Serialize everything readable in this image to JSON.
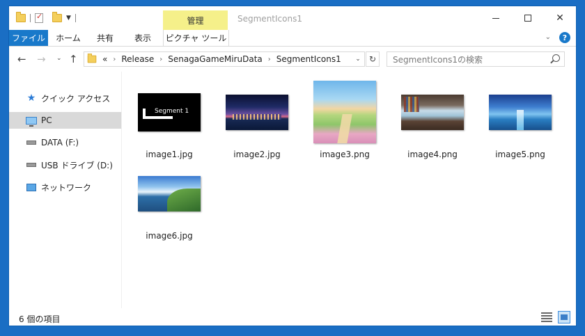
{
  "window": {
    "title": "SegmentIcons1",
    "manage_tab": "管理",
    "controls": {
      "minimize": "—",
      "maximize": "☐",
      "close": "✕"
    }
  },
  "ribbon": {
    "tabs": [
      {
        "label": "ファイル",
        "active": true
      },
      {
        "label": "ホーム"
      },
      {
        "label": "共有"
      },
      {
        "label": "表示"
      },
      {
        "label": "ピクチャ ツール"
      }
    ],
    "help_label": "?"
  },
  "address": {
    "overflow": "«",
    "crumbs": [
      "Release",
      "SenagaGameMiruData",
      "SegmentIcons1"
    ],
    "search_placeholder": "SegmentIcons1の検索"
  },
  "nav": {
    "items": [
      {
        "label": "クイック アクセス",
        "icon": "star-icon"
      },
      {
        "label": "PC",
        "icon": "pc-icon",
        "selected": true
      },
      {
        "label": "DATA (F:)",
        "icon": "drive-icon"
      },
      {
        "label": "USB ドライブ (D:)",
        "icon": "usb-drive-icon"
      },
      {
        "label": "ネットワーク",
        "icon": "network-icon"
      }
    ]
  },
  "files": [
    {
      "name": "image1.jpg",
      "thumb_text": "Segment 1"
    },
    {
      "name": "image2.jpg"
    },
    {
      "name": "image3.png"
    },
    {
      "name": "image4.png"
    },
    {
      "name": "image5.png"
    },
    {
      "name": "image6.jpg"
    }
  ],
  "status": {
    "item_count": "6 個の項目"
  },
  "colors": {
    "accent": "#1979ca",
    "manage_tab_bg": "#f5f08a",
    "selected_nav": "#d9d9d9"
  }
}
